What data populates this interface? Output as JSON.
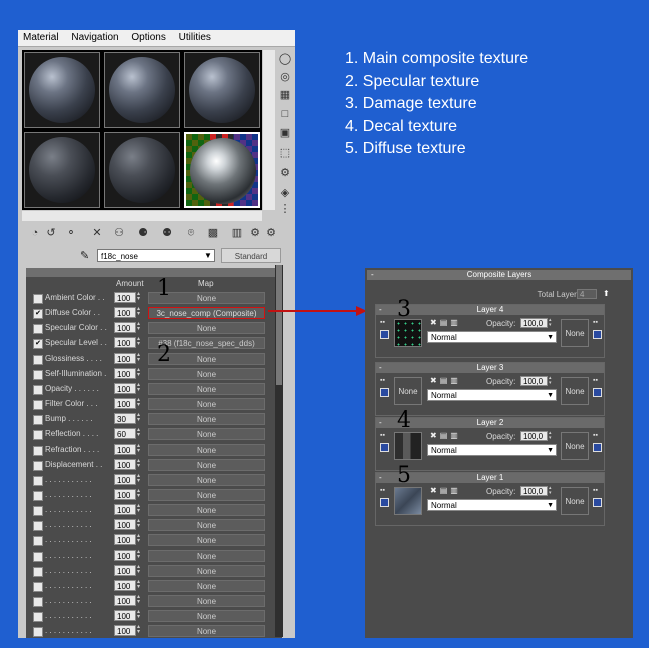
{
  "menubar": [
    "Material",
    "Navigation",
    "Options",
    "Utilities"
  ],
  "material_name": "f18c_nose",
  "material_type": "Standard",
  "maps_header": {
    "amount": "Amount",
    "map": "Map"
  },
  "map_rows": [
    {
      "checked": false,
      "label": "Ambient Color . .",
      "amount": "100",
      "map": "None"
    },
    {
      "checked": true,
      "label": "Diffuse Color . .",
      "amount": "100",
      "map": "3c_nose_comp (Composite)"
    },
    {
      "checked": false,
      "label": "Specular Color . .",
      "amount": "100",
      "map": "None"
    },
    {
      "checked": true,
      "label": "Specular Level . .",
      "amount": "100",
      "map": "#38 (f18c_nose_spec_dds)"
    },
    {
      "checked": false,
      "label": "Glossiness . . . .",
      "amount": "100",
      "map": "None"
    },
    {
      "checked": false,
      "label": "Self-Illumination .",
      "amount": "100",
      "map": "None"
    },
    {
      "checked": false,
      "label": "Opacity . . . . . .",
      "amount": "100",
      "map": "None"
    },
    {
      "checked": false,
      "label": "Filter Color . . .",
      "amount": "100",
      "map": "None"
    },
    {
      "checked": false,
      "label": "Bump . . . . . .",
      "amount": "30",
      "map": "None"
    },
    {
      "checked": false,
      "label": "Reflection . . . .",
      "amount": "60",
      "map": "None"
    },
    {
      "checked": false,
      "label": "Refraction . . . .",
      "amount": "100",
      "map": "None"
    },
    {
      "checked": false,
      "label": "Displacement . .",
      "amount": "100",
      "map": "None"
    },
    {
      "checked": false,
      "label": ". . . . . . . . . . .",
      "amount": "100",
      "map": "None"
    },
    {
      "checked": false,
      "label": ". . . . . . . . . . .",
      "amount": "100",
      "map": "None"
    },
    {
      "checked": false,
      "label": ". . . . . . . . . . .",
      "amount": "100",
      "map": "None"
    },
    {
      "checked": false,
      "label": ". . . . . . . . . . .",
      "amount": "100",
      "map": "None"
    },
    {
      "checked": false,
      "label": ". . . . . . . . . . .",
      "amount": "100",
      "map": "None"
    },
    {
      "checked": false,
      "label": ". . . . . . . . . . .",
      "amount": "100",
      "map": "None"
    },
    {
      "checked": false,
      "label": ". . . . . . . . . . .",
      "amount": "100",
      "map": "None"
    },
    {
      "checked": false,
      "label": ". . . . . . . . . . .",
      "amount": "100",
      "map": "None"
    },
    {
      "checked": false,
      "label": ". . . . . . . . . . .",
      "amount": "100",
      "map": "None"
    },
    {
      "checked": false,
      "label": ". . . . . . . . . . .",
      "amount": "100",
      "map": "None"
    },
    {
      "checked": false,
      "label": ". . . . . . . . . . .",
      "amount": "100",
      "map": "None"
    },
    {
      "checked": false,
      "label": ". . . . . . . . . . .",
      "amount": "100",
      "map": "None"
    }
  ],
  "callouts": {
    "n1": "1",
    "n2": "2",
    "n3": "3",
    "n4": "4",
    "n5": "5"
  },
  "legend": [
    "1. Main composite texture",
    "2. Specular texture",
    "3. Damage texture",
    "4. Decal texture",
    "5. Diffuse texture"
  ],
  "composite": {
    "title": "Composite Layers",
    "collapse": "-",
    "total_layers_label": "Total Layers:",
    "total_layers": "4",
    "layers": [
      {
        "name": "Layer 4",
        "opacity_label": "Opacity:",
        "opacity": "100,0",
        "blend": "Normal",
        "mask": "None",
        "texture": "",
        "thumb": "stars"
      },
      {
        "name": "Layer 3",
        "opacity_label": "Opacity:",
        "opacity": "100,0",
        "blend": "Normal",
        "mask": "None",
        "texture": "None",
        "thumb": "none"
      },
      {
        "name": "Layer 2",
        "opacity_label": "Opacity:",
        "opacity": "100,0",
        "blend": "Normal",
        "mask": "None",
        "texture": "",
        "thumb": "tex2"
      },
      {
        "name": "Layer 1",
        "opacity_label": "Opacity:",
        "opacity": "100,0",
        "blend": "Normal",
        "mask": "None",
        "texture": "",
        "thumb": "tex1"
      }
    ]
  },
  "colors": {
    "background": "#1f5fd0",
    "highlight": "#d11111",
    "panel": "#4b4b4b"
  }
}
